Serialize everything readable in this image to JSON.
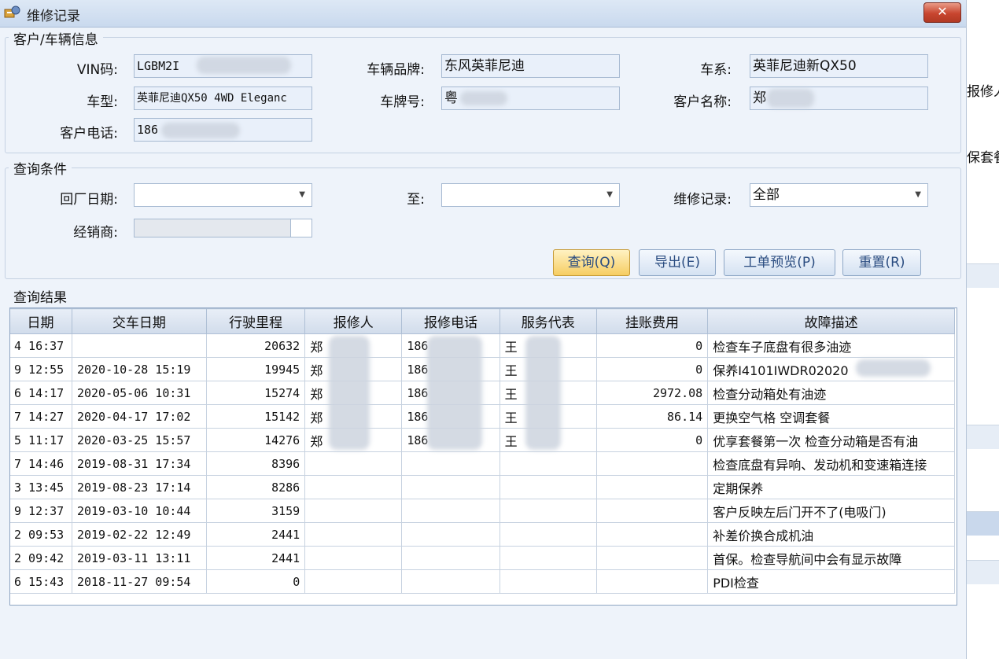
{
  "window": {
    "title": "维修记录",
    "close_label": "✕"
  },
  "customer_group": {
    "title": "客户/车辆信息",
    "vin_label": "VIN码:",
    "vin_value": "LGBM2I",
    "brand_label": "车辆品牌:",
    "brand_value": "东风英菲尼迪",
    "series_label": "车系:",
    "series_value": "英菲尼迪新QX50",
    "model_label": "车型:",
    "model_value": "英菲尼迪QX50 4WD Eleganc",
    "plate_label": "车牌号:",
    "plate_value": "粤",
    "customer_name_label": "客户名称:",
    "customer_name_value": "郑",
    "phone_label": "客户电话:",
    "phone_value": "186"
  },
  "query_group": {
    "title": "查询条件",
    "return_date_label": "回厂日期:",
    "return_date_value": "",
    "to_label": "至:",
    "to_value": "",
    "record_label": "维修记录:",
    "record_value": "全部",
    "dealer_label": "经销商:"
  },
  "actions": {
    "query": "查询(Q)",
    "export": "导出(E)",
    "preview": "工单预览(P)",
    "reset": "重置(R)"
  },
  "results": {
    "title": "查询结果",
    "columns": [
      "日期",
      "交车日期",
      "行驶里程",
      "报修人",
      "报修电话",
      "服务代表",
      "挂账费用",
      "故障描述"
    ],
    "rows": [
      [
        "4 16:37",
        "",
        "20632",
        "郑",
        "186",
        "王",
        "0",
        "检查车子底盘有很多油迹"
      ],
      [
        "9 12:55",
        "2020-10-28 15:19",
        "19945",
        "郑",
        "186",
        "王",
        "0",
        "保养I4101IWDR02020"
      ],
      [
        "6 14:17",
        "2020-05-06 10:31",
        "15274",
        "郑",
        "186",
        "王",
        "2972.08",
        "检查分动箱处有油迹"
      ],
      [
        "7 14:27",
        "2020-04-17 17:02",
        "15142",
        "郑",
        "186",
        "王",
        "86.14",
        "更换空气格 空调套餐"
      ],
      [
        "5 11:17",
        "2020-03-25 15:57",
        "14276",
        "郑",
        "186",
        "王",
        "0",
        "优享套餐第一次 检查分动箱是否有油"
      ],
      [
        "7 14:46",
        "2019-08-31 17:34",
        "8396",
        "",
        "",
        "",
        "",
        "检查底盘有异响、发动机和变速箱连接"
      ],
      [
        "3 13:45",
        "2019-08-23 17:14",
        "8286",
        "",
        "",
        "",
        "",
        "定期保养"
      ],
      [
        "9 12:37",
        "2019-03-10 10:44",
        "3159",
        "",
        "",
        "",
        "",
        "客户反映左后门开不了(电吸门)"
      ],
      [
        "2 09:53",
        "2019-02-22 12:49",
        "2441",
        "",
        "",
        "",
        "",
        "补差价换合成机油"
      ],
      [
        "2 09:42",
        "2019-03-11 13:11",
        "2441",
        "",
        "",
        "",
        "",
        "首保。检查导航间中会有显示故障"
      ],
      [
        "6 15:43",
        "2018-11-27 09:54",
        "0",
        "",
        "",
        "",
        "",
        "PDI检查"
      ]
    ]
  },
  "right_strip": {
    "text1": "报修人",
    "text2": "保套餐"
  }
}
